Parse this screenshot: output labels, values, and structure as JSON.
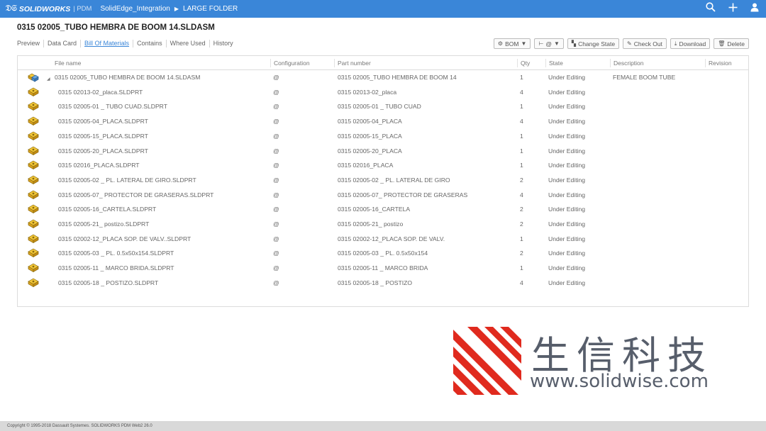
{
  "topbar": {
    "brand": "SOLIDWORKS",
    "brand_suffix": "| PDM",
    "breadcrumb": [
      "SolidEdge_Integration",
      "LARGE FOLDER"
    ]
  },
  "document": {
    "title": "0315 02005_TUBO HEMBRA DE BOOM 14.SLDASM"
  },
  "tabs": [
    {
      "label": "Preview"
    },
    {
      "label": "Data Card"
    },
    {
      "label": "Bill Of Materials",
      "active": true
    },
    {
      "label": "Contains"
    },
    {
      "label": "Where Used"
    },
    {
      "label": "History"
    }
  ],
  "actions": {
    "bom": "BOM",
    "config": "@",
    "change_state": "Change State",
    "check_out": "Check Out",
    "download": "Download",
    "delete": "Delete"
  },
  "columns": {
    "file_name": "File name",
    "configuration": "Configuration",
    "part_number": "Part number",
    "qty": "Qty",
    "state": "State",
    "description": "Description",
    "revision": "Revision"
  },
  "rows": [
    {
      "file": "0315 02005_TUBO HEMBRA DE BOOM 14.SLDASM",
      "config": "@",
      "part": "0315 02005_TUBO HEMBRA DE BOOM 14",
      "qty": "1",
      "state": "Under Editing",
      "desc": "FEMALE BOOM TUBE",
      "rev": "",
      "type": "assembly"
    },
    {
      "file": "0315 02013-02_placa.SLDPRT",
      "config": "@",
      "part": "0315 02013-02_placa",
      "qty": "4",
      "state": "Under Editing",
      "desc": "",
      "rev": "",
      "type": "part"
    },
    {
      "file": "0315 02005-01 _ TUBO CUAD.SLDPRT",
      "config": "@",
      "part": "0315 02005-01 _ TUBO CUAD",
      "qty": "1",
      "state": "Under Editing",
      "desc": "",
      "rev": "",
      "type": "part"
    },
    {
      "file": "0315 02005-04_PLACA.SLDPRT",
      "config": "@",
      "part": "0315 02005-04_PLACA",
      "qty": "4",
      "state": "Under Editing",
      "desc": "",
      "rev": "",
      "type": "part"
    },
    {
      "file": "0315 02005-15_PLACA.SLDPRT",
      "config": "@",
      "part": "0315 02005-15_PLACA",
      "qty": "1",
      "state": "Under Editing",
      "desc": "",
      "rev": "",
      "type": "part"
    },
    {
      "file": "0315 02005-20_PLACA.SLDPRT",
      "config": "@",
      "part": "0315 02005-20_PLACA",
      "qty": "1",
      "state": "Under Editing",
      "desc": "",
      "rev": "",
      "type": "part"
    },
    {
      "file": "0315 02016_PLACA.SLDPRT",
      "config": "@",
      "part": "0315 02016_PLACA",
      "qty": "1",
      "state": "Under Editing",
      "desc": "",
      "rev": "",
      "type": "part"
    },
    {
      "file": "0315 02005-02 _ PL. LATERAL DE GIRO.SLDPRT",
      "config": "@",
      "part": "0315 02005-02 _ PL. LATERAL DE GIRO",
      "qty": "2",
      "state": "Under Editing",
      "desc": "",
      "rev": "",
      "type": "part"
    },
    {
      "file": "0315 02005-07_ PROTECTOR DE GRASERAS.SLDPRT",
      "config": "@",
      "part": "0315 02005-07_ PROTECTOR DE GRASERAS",
      "qty": "4",
      "state": "Under Editing",
      "desc": "",
      "rev": "",
      "type": "part"
    },
    {
      "file": "0315 02005-16_CARTELA.SLDPRT",
      "config": "@",
      "part": "0315 02005-16_CARTELA",
      "qty": "2",
      "state": "Under Editing",
      "desc": "",
      "rev": "",
      "type": "part"
    },
    {
      "file": "0315 02005-21_ postizo.SLDPRT",
      "config": "@",
      "part": "0315 02005-21_ postizo",
      "qty": "2",
      "state": "Under Editing",
      "desc": "",
      "rev": "",
      "type": "part"
    },
    {
      "file": "0315 02002-12_PLACA SOP. DE VALV..SLDPRT",
      "config": "@",
      "part": "0315 02002-12_PLACA SOP. DE VALV.",
      "qty": "1",
      "state": "Under Editing",
      "desc": "",
      "rev": "",
      "type": "part"
    },
    {
      "file": "0315 02005-03 _ PL. 0.5x50x154.SLDPRT",
      "config": "@",
      "part": "0315 02005-03 _ PL. 0.5x50x154",
      "qty": "2",
      "state": "Under Editing",
      "desc": "",
      "rev": "",
      "type": "part"
    },
    {
      "file": "0315 02005-11 _ MARCO BRIDA.SLDPRT",
      "config": "@",
      "part": "0315 02005-11 _ MARCO BRIDA",
      "qty": "1",
      "state": "Under Editing",
      "desc": "",
      "rev": "",
      "type": "part"
    },
    {
      "file": "0315 02005-18 _ POSTIZO.SLDPRT",
      "config": "@",
      "part": "0315 02005-18 _ POSTIZO",
      "qty": "4",
      "state": "Under Editing",
      "desc": "",
      "rev": "",
      "type": "part"
    }
  ],
  "watermark": {
    "brand_cn": "生信科技",
    "url": "www.solidwise.com"
  },
  "footer": {
    "copyright": "Copyright © 1995-2018 Dassault Systemes. SOLIDWORKS PDM Web2 26.0"
  }
}
